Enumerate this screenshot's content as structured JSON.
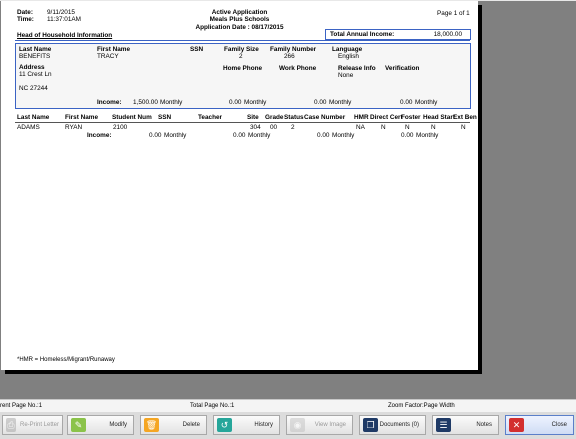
{
  "report": {
    "date_label": "Date:",
    "date_value": "9/11/2015",
    "time_label": "Time:",
    "time_value": "11:37:01AM",
    "title": "Active Application",
    "school": "Meals Plus Schools",
    "app_date": "Application Date : 08/17/2015",
    "page_info": "Page 1 of 1",
    "hoh_heading": "Head of Household Information",
    "total_income_label": "Total Annual Income:",
    "total_income_value": "18,000.00"
  },
  "household": {
    "labels": {
      "last_name": "Last Name",
      "first_name": "First Name",
      "ssn": "SSN",
      "family_size": "Family Size",
      "family_number": "Family Number",
      "language": "Language",
      "address": "Address",
      "home_phone": "Home Phone",
      "work_phone": "Work Phone",
      "release_info": "Release Info",
      "verification": "Verification",
      "income": "Income:"
    },
    "last_name": "BENEFITS",
    "first_name": "TRACY",
    "family_size": "2",
    "family_number": "266",
    "language": "English",
    "address_line1": "11 Crest Ln",
    "address_line2": "NC 27244",
    "release_info": "None",
    "income": [
      {
        "amount": "1,500.00",
        "period": "Monthly"
      },
      {
        "amount": "0.00",
        "period": "Monthly"
      },
      {
        "amount": "0.00",
        "period": "Monthly"
      },
      {
        "amount": "0.00",
        "period": "Monthly"
      }
    ]
  },
  "students": {
    "headers": {
      "last_name": "Last Name",
      "first_name": "First Name",
      "student_num": "Student Num",
      "ssn": "SSN",
      "teacher": "Teacher",
      "site": "Site",
      "grade": "Grade",
      "status": "Status",
      "case_number": "Case Number",
      "hmr": "HMR",
      "direct_cert": "Direct Cert",
      "foster": "Foster",
      "head_start": "Head Start",
      "ext_ben": "Ext Ben"
    },
    "rows": [
      {
        "last_name": "ADAMS",
        "first_name": "RYAN",
        "student_num": "2100",
        "site": "304",
        "grade": "00",
        "status": "2",
        "hmr": "NA",
        "direct_cert": "N",
        "foster": "N",
        "head_start": "N",
        "ext_ben": "N",
        "income_label": "Income:",
        "income": [
          {
            "amount": "0.00",
            "period": "Monthly"
          },
          {
            "amount": "0.00",
            "period": "Monthly"
          },
          {
            "amount": "0.00",
            "period": "Monthly"
          },
          {
            "amount": "0.00",
            "period": "Monthly"
          }
        ]
      }
    ]
  },
  "footnote": "*HMR = Homeless/Migrant/Runaway",
  "status_bar": {
    "current_page": "rent Page No.:1",
    "total_page": "Total Page No.:1",
    "zoom": "Zoom Factor:Page Width"
  },
  "toolbar": {
    "reprint": "Re-Print Letter",
    "modify": "Modify",
    "delete": "Delete",
    "history": "History",
    "view_image": "View Image",
    "documents": "Documents (0)",
    "notes": "Notes",
    "close": "Close"
  },
  "colors": {
    "accent_border": "#3b63c4",
    "modify_icon": "#8bc34a",
    "delete_icon": "#f5a623",
    "history_icon": "#26a69a",
    "documents_icon": "#1f3a66",
    "notes_icon": "#1f3a66",
    "close_icon": "#d32f2f"
  }
}
